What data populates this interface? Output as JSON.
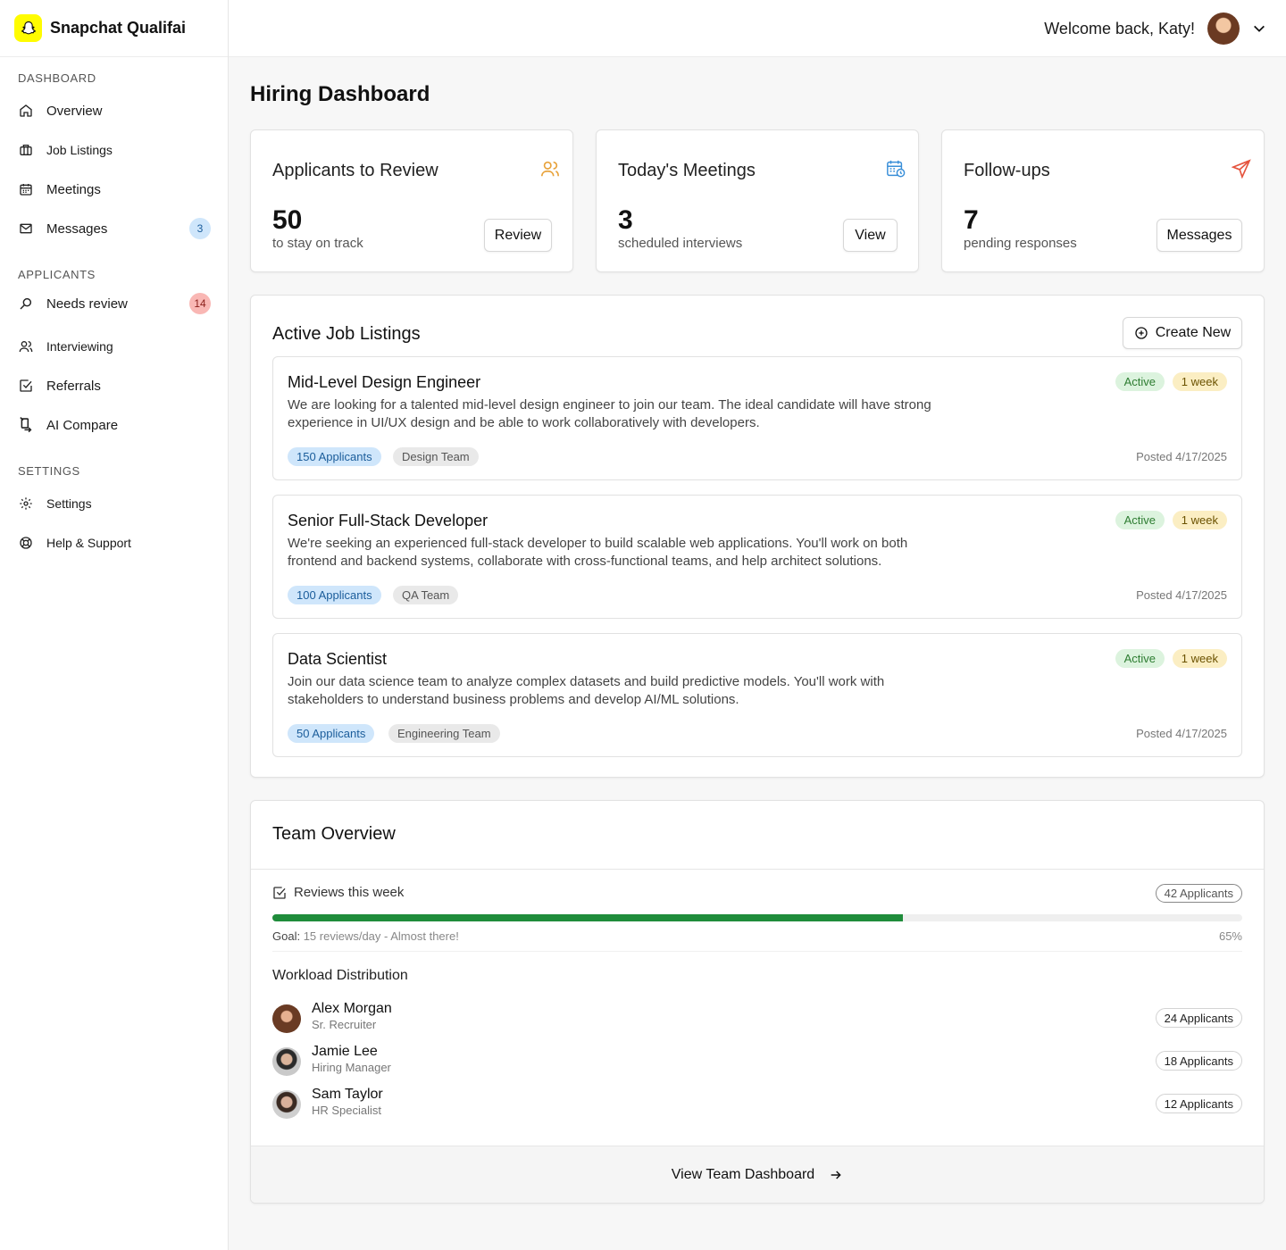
{
  "brand": {
    "name": "Snapchat Qualifai",
    "logo_icon": "snapchat-ghost-icon",
    "logo_color": "#FFFC00"
  },
  "header": {
    "welcome": "Welcome back, Katy!",
    "menu_icon": "chevron-down-icon"
  },
  "sidebar": {
    "sections": [
      {
        "title": "DASHBOARD"
      },
      {
        "title": "APPLICANTS"
      },
      {
        "title": "SETTINGS"
      }
    ],
    "items": [
      {
        "label": "Overview",
        "icon": "home-icon"
      },
      {
        "label": "Job Listings",
        "icon": "briefcase-icon"
      },
      {
        "label": "Meetings",
        "icon": "calendar-icon"
      },
      {
        "label": "Messages",
        "icon": "mail-icon",
        "badge": "3"
      },
      {
        "label": "Needs review",
        "icon": "search-icon",
        "badge": "14"
      },
      {
        "label": "Interviewing",
        "icon": "users-icon"
      },
      {
        "label": "Referrals",
        "icon": "checkbox-icon"
      },
      {
        "label": "AI Compare",
        "icon": "compare-icon"
      },
      {
        "label": "Settings",
        "icon": "gear-icon"
      },
      {
        "label": "Help & Support",
        "icon": "lifebuoy-icon"
      }
    ]
  },
  "main": {
    "title": "Hiring Dashboard",
    "stats": [
      {
        "title": "Applicants to Review",
        "value": "50",
        "sub": "to stay on track",
        "button": "Review",
        "icon": "users-icon",
        "icon_color": "#E8A23A"
      },
      {
        "title": "Today's Meetings",
        "value": "3",
        "sub": "scheduled interviews",
        "button": "View",
        "icon": "calendar-clock-icon",
        "icon_color": "#3A8FD8"
      },
      {
        "title": "Follow-ups",
        "value": "7",
        "sub": "pending responses",
        "button": "Messages",
        "icon": "send-icon",
        "icon_color": "#E5533D"
      }
    ],
    "jobs": {
      "title": "Active Job Listings",
      "create_label": "Create New",
      "items": [
        {
          "title": "Mid-Level Design Engineer",
          "description": "We are looking for a talented mid-level design engineer to join our team. The ideal candidate will have strong experience in UI/UX design and be able to work collaboratively with developers.",
          "applicants": "150 Applicants",
          "team": "Design Team",
          "status": "Active",
          "duration": "1 week",
          "posted": "Posted 4/17/2025"
        },
        {
          "title": "Senior Full-Stack Developer",
          "description": "We're seeking an experienced full-stack developer to build scalable web applications. You'll work on both frontend and backend systems, collaborate with cross-functional teams, and help architect solutions.",
          "applicants": "100 Applicants",
          "team": "QA Team",
          "status": "Active",
          "duration": "1 week",
          "posted": "Posted 4/17/2025"
        },
        {
          "title": "Data Scientist",
          "description": "Join our data science team to analyze complex datasets and build predictive models. You'll work with stakeholders to understand business problems and develop AI/ML solutions.",
          "applicants": "50 Applicants",
          "team": "Engineering Team",
          "status": "Active",
          "duration": "1 week",
          "posted": "Posted 4/17/2025"
        }
      ]
    },
    "team": {
      "title": "Team Overview",
      "reviews_label": "Reviews this week",
      "reviews_badge": "42 Applicants",
      "progress": 0.65,
      "goal_prefix": "Goal:",
      "goal_text": "15 reviews/day - Almost there!",
      "percent": "65%",
      "workload_title": "Workload Distribution",
      "members": [
        {
          "name": "Alex Morgan",
          "role": "Sr. Recruiter",
          "count": "24 Applicants"
        },
        {
          "name": "Jamie Lee",
          "role": "Hiring Manager",
          "count": "18 Applicants"
        },
        {
          "name": "Sam Taylor",
          "role": "HR Specialist",
          "count": "12 Applicants"
        }
      ],
      "footer_link": "View Team Dashboard"
    }
  },
  "colors": {
    "progress": "#1F8C3B",
    "badge_blue": "#CFE6FB",
    "badge_red": "#F9B7B4"
  }
}
